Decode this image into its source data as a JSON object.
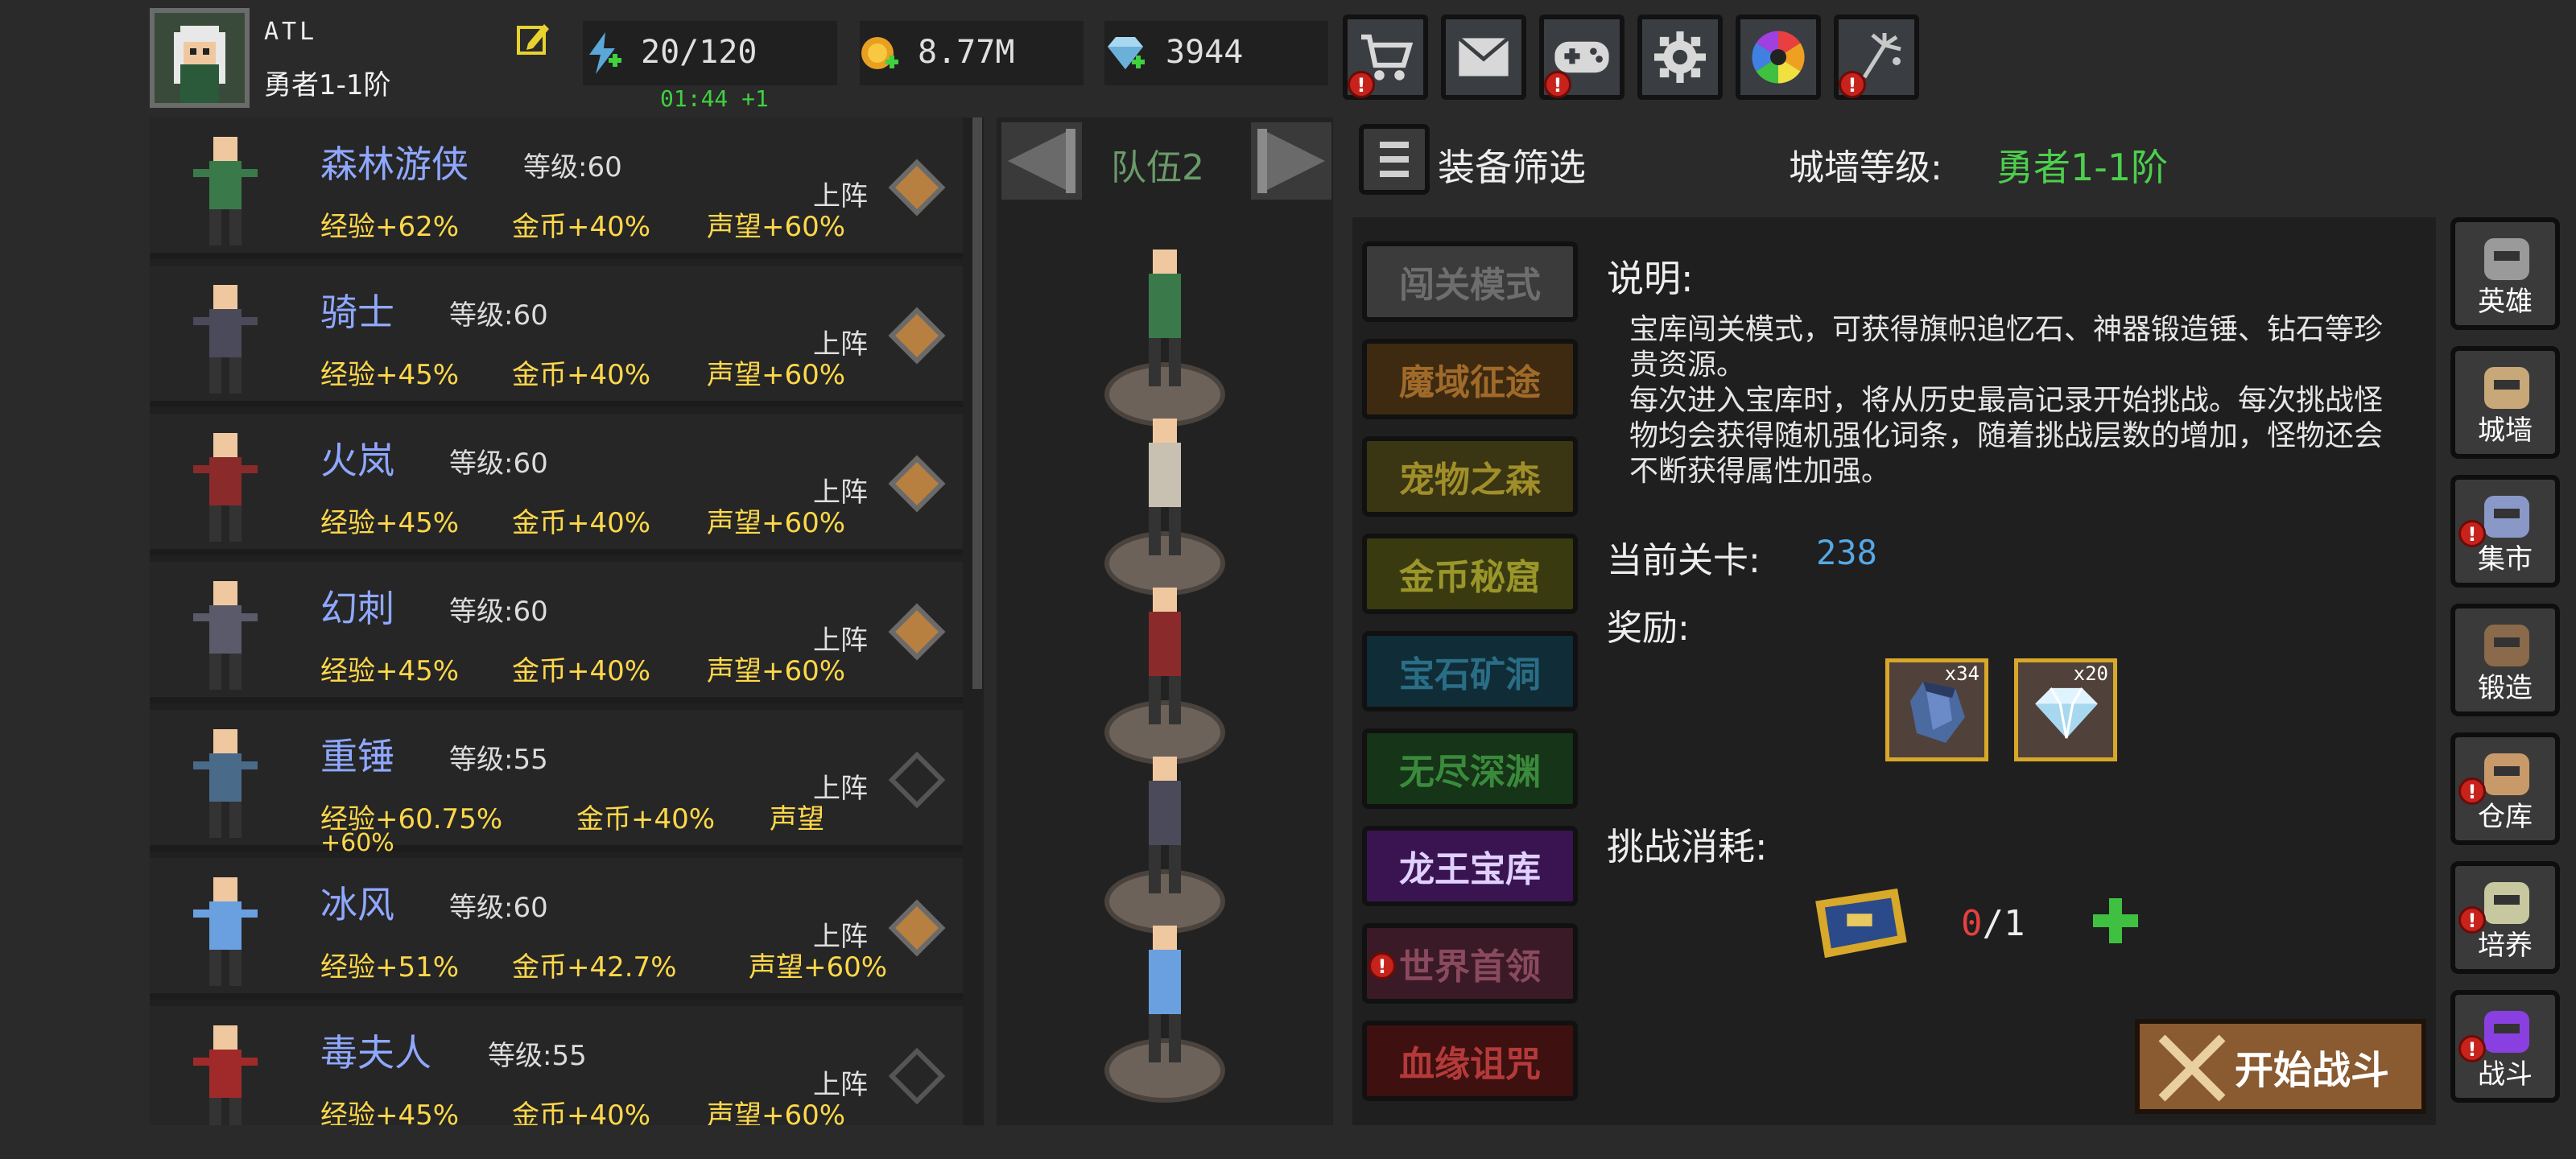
{
  "player": {
    "name": "ATL",
    "rank": "勇者1-1阶"
  },
  "resources": {
    "stamina": "20/120",
    "stamina_timer": "01:44 +1",
    "gold": "8.77M",
    "diamonds": "3944"
  },
  "top_buttons": [
    {
      "name": "shop",
      "icon": "cart-icon",
      "alert": true
    },
    {
      "name": "mail",
      "icon": "mail-icon",
      "alert": false
    },
    {
      "name": "gamepad",
      "icon": "gamepad-icon",
      "alert": true
    },
    {
      "name": "settings",
      "icon": "gear-icon",
      "alert": false
    },
    {
      "name": "aperture",
      "icon": "aperture-icon",
      "alert": false
    },
    {
      "name": "fireworks",
      "icon": "fireworks-icon",
      "alert": true
    }
  ],
  "heroes": [
    {
      "name": "森林游侠",
      "level": "等级:60",
      "exp": "经验+62%",
      "gold": "金币+40%",
      "fame": "声望+60%",
      "deploy": "上阵",
      "active": true
    },
    {
      "name": "骑士",
      "level": "等级:60",
      "exp": "经验+45%",
      "gold": "金币+40%",
      "fame": "声望+60%",
      "deploy": "上阵",
      "active": true
    },
    {
      "name": "火岚",
      "level": "等级:60",
      "exp": "经验+45%",
      "gold": "金币+40%",
      "fame": "声望+60%",
      "deploy": "上阵",
      "active": true
    },
    {
      "name": "幻刺",
      "level": "等级:60",
      "exp": "经验+45%",
      "gold": "金币+40%",
      "fame": "声望+60%",
      "deploy": "上阵",
      "active": true
    },
    {
      "name": "重锤",
      "level": "等级:55",
      "exp": "经验+60.75%",
      "gold": "金币+40%",
      "fame": "声望",
      "fame2": "+60%",
      "deploy": "上阵",
      "active": false
    },
    {
      "name": "冰风",
      "level": "等级:60",
      "exp": "经验+51%",
      "gold": "金币+42.7%",
      "fame": "声望+60%",
      "deploy": "上阵",
      "active": true
    },
    {
      "name": "毒夫人",
      "level": "等级:55",
      "exp": "经验+45%",
      "gold": "金币+40%",
      "fame": "声望+60%",
      "deploy": "上阵",
      "active": false
    }
  ],
  "team": {
    "title": "队伍2"
  },
  "filter": {
    "label": "装备筛选"
  },
  "wall": {
    "label": "城墙等级:",
    "value": "勇者1-1阶"
  },
  "modes": [
    {
      "label": "闯关模式",
      "bg": "#3b3b3b",
      "fg": "#6e6e6e",
      "alert": false
    },
    {
      "label": "魔域征途",
      "bg": "#3d2a10",
      "fg": "#a06a2a",
      "alert": false
    },
    {
      "label": "宠物之森",
      "bg": "#3a3512",
      "fg": "#a08e2a",
      "alert": false
    },
    {
      "label": "金币秘窟",
      "bg": "#3a3a10",
      "fg": "#9a962a",
      "alert": false
    },
    {
      "label": "宝石矿洞",
      "bg": "#102c36",
      "fg": "#2a6e86",
      "alert": false
    },
    {
      "label": "无尽深渊",
      "bg": "#163418",
      "fg": "#3a8a3c",
      "alert": false
    },
    {
      "label": "龙王宝库",
      "bg": "#3a1450",
      "fg": "#e0d0ff",
      "alert": false
    },
    {
      "label": "世界首领",
      "bg": "#3a1a26",
      "fg": "#8a4a5e",
      "alert": true
    },
    {
      "label": "血缘诅咒",
      "bg": "#3e1010",
      "fg": "#b43a3a",
      "alert": false
    }
  ],
  "detail": {
    "desc_title": "说明:",
    "desc_1": "宝库闯关模式，可获得旗帜追忆石、神器锻造锤、钻石等珍贵资源。",
    "desc_2": "每次进入宝库时，将从历史最高记录开始挑战。每次挑战怪物均会获得随机强化词条，随着挑战层数的增加，怪物还会不断获得属性加强。",
    "stage_label": "当前关卡:",
    "stage_value": "238",
    "reward_label": "奖励:",
    "rewards": [
      {
        "item": "stone-icon",
        "count": "x34"
      },
      {
        "item": "diamond-icon",
        "count": "x20"
      }
    ],
    "cost_label": "挑战消耗:",
    "cost_have": "0",
    "cost_sep": "/",
    "cost_need": "1",
    "start_label": "开始战斗"
  },
  "side_nav": [
    {
      "label": "英雄",
      "icon": "helmet-icon",
      "alert": false
    },
    {
      "label": "城墙",
      "icon": "colosseum-icon",
      "alert": false
    },
    {
      "label": "集市",
      "icon": "market-icon",
      "alert": true
    },
    {
      "label": "锻造",
      "icon": "anvil-icon",
      "alert": false
    },
    {
      "label": "仓库",
      "icon": "storage-icon",
      "alert": true
    },
    {
      "label": "培养",
      "icon": "chalice-icon",
      "alert": true
    },
    {
      "label": "战斗",
      "icon": "portal-icon",
      "alert": true
    }
  ],
  "colors": {
    "accent_green": "#4cd04c",
    "hero_name": "#8fa8ff",
    "stat": "#ffd84a",
    "alert": "#c8221c"
  }
}
